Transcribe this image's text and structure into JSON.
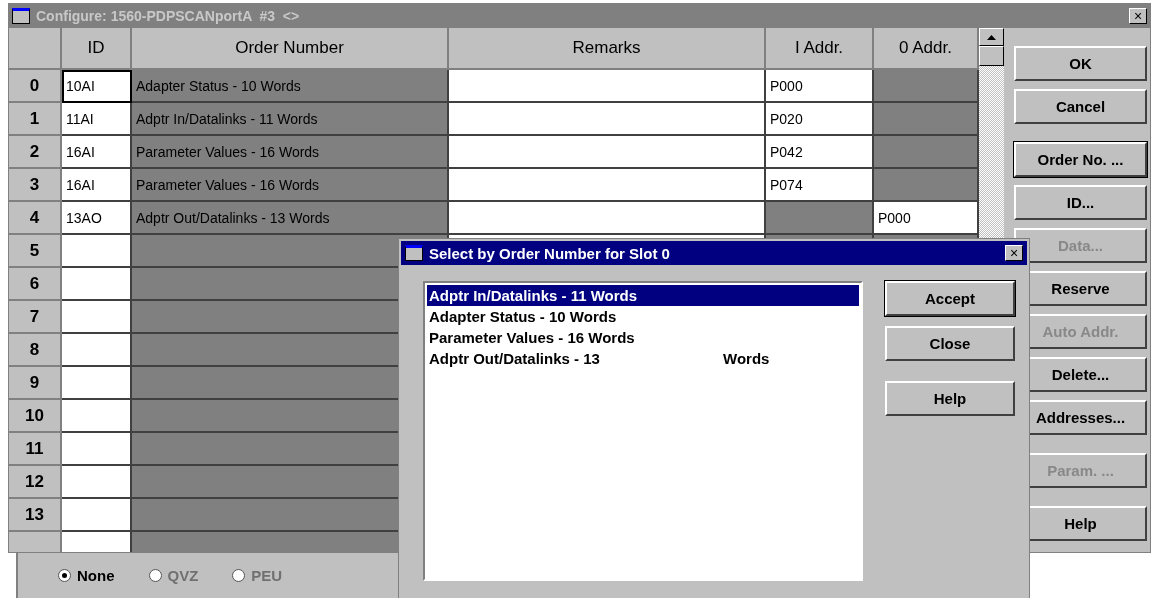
{
  "window": {
    "title": "Configure: 1560-PDPSCANportA  #3  <>",
    "close": "×"
  },
  "table": {
    "columns": [
      "ID",
      "Order Number",
      "Remarks",
      "I Addr.",
      "0 Addr."
    ],
    "rows": [
      {
        "label": "0",
        "cells": [
          {
            "text": "10AI",
            "editable": true,
            "focused": true
          },
          {
            "text": "Adapter Status - 10 Words",
            "editable": false
          },
          {
            "editable": true
          },
          {
            "text": "P000",
            "editable": true
          },
          {
            "editable": false
          }
        ]
      },
      {
        "label": "1",
        "cells": [
          {
            "text": "11AI",
            "editable": true
          },
          {
            "text": "Adptr In/Datalinks - 11 Words",
            "editable": false
          },
          {
            "editable": true
          },
          {
            "text": "P020",
            "editable": true
          },
          {
            "editable": false
          }
        ]
      },
      {
        "label": "2",
        "cells": [
          {
            "text": "16AI",
            "editable": true
          },
          {
            "text": "Parameter Values - 16 Words",
            "editable": false
          },
          {
            "editable": true
          },
          {
            "text": "P042",
            "editable": true
          },
          {
            "editable": false
          }
        ]
      },
      {
        "label": "3",
        "cells": [
          {
            "text": "16AI",
            "editable": true
          },
          {
            "text": "Parameter Values - 16 Words",
            "editable": false
          },
          {
            "editable": true
          },
          {
            "text": "P074",
            "editable": true
          },
          {
            "editable": false
          }
        ]
      },
      {
        "label": "4",
        "cells": [
          {
            "text": "13AO",
            "editable": true
          },
          {
            "text": "Adptr Out/Datalinks - 13 Words",
            "editable": false
          },
          {
            "editable": true
          },
          {
            "editable": false
          },
          {
            "text": "P000",
            "editable": true
          }
        ]
      },
      {
        "label": "5",
        "cells": [
          {
            "editable": true
          },
          {
            "editable": false
          }
        ]
      },
      {
        "label": "6",
        "cells": [
          {
            "editable": true
          },
          {
            "editable": false
          }
        ]
      },
      {
        "label": "7",
        "cells": [
          {
            "editable": true
          },
          {
            "editable": false
          }
        ]
      },
      {
        "label": "8",
        "cells": [
          {
            "editable": true
          },
          {
            "editable": false
          }
        ]
      },
      {
        "label": "9",
        "cells": [
          {
            "editable": true
          },
          {
            "editable": false
          }
        ]
      },
      {
        "label": "10",
        "cells": [
          {
            "editable": true
          },
          {
            "editable": false
          }
        ]
      },
      {
        "label": "11",
        "cells": [
          {
            "editable": true
          },
          {
            "editable": false
          }
        ]
      },
      {
        "label": "12",
        "cells": [
          {
            "editable": true
          },
          {
            "editable": false
          }
        ]
      },
      {
        "label": "13",
        "cells": [
          {
            "editable": true
          },
          {
            "editable": false
          }
        ]
      },
      {
        "cells": [
          {
            "editable": true
          },
          {
            "editable": false
          }
        ]
      }
    ]
  },
  "button_groups": [
    [
      {
        "label": "OK",
        "disabled": false
      },
      {
        "label": "Cancel",
        "disabled": false
      }
    ],
    [
      {
        "label": "Order No. ...",
        "disabled": false,
        "default": true
      },
      {
        "label": "ID...",
        "disabled": false
      },
      {
        "label": "Data...",
        "disabled": true
      },
      {
        "label": "Reserve",
        "disabled": false
      },
      {
        "label": "Auto Addr.",
        "disabled": true
      },
      {
        "label": "Delete...",
        "disabled": false
      },
      {
        "label": "Addresses...",
        "disabled": false
      }
    ],
    [
      {
        "label": "Param. ...",
        "disabled": true
      }
    ],
    [
      {
        "label": "Help",
        "disabled": false
      }
    ]
  ],
  "background_panel": {
    "radios": [
      {
        "label": "None",
        "selected": true,
        "disabled": false
      },
      {
        "label": "QVZ",
        "selected": false,
        "disabled": true
      },
      {
        "label": "PEU",
        "selected": false,
        "disabled": true
      }
    ]
  },
  "dialog": {
    "title": "Select by Order Number for Slot 0",
    "close": "×",
    "items": [
      {
        "text": "Adptr In/Datalinks - 11 Words",
        "selected": true
      },
      {
        "text": "Adapter Status - 10 Words",
        "selected": false
      },
      {
        "text": "Parameter Values - 16 Words",
        "selected": false
      },
      {
        "text": "Adptr Out/Datalinks - 13",
        "suffix": "Words",
        "selected": false
      }
    ],
    "button_groups": [
      [
        {
          "label": "Accept",
          "default": true
        },
        {
          "label": "Close",
          "default": false
        }
      ],
      [
        {
          "label": "Help",
          "default": false
        }
      ]
    ]
  }
}
